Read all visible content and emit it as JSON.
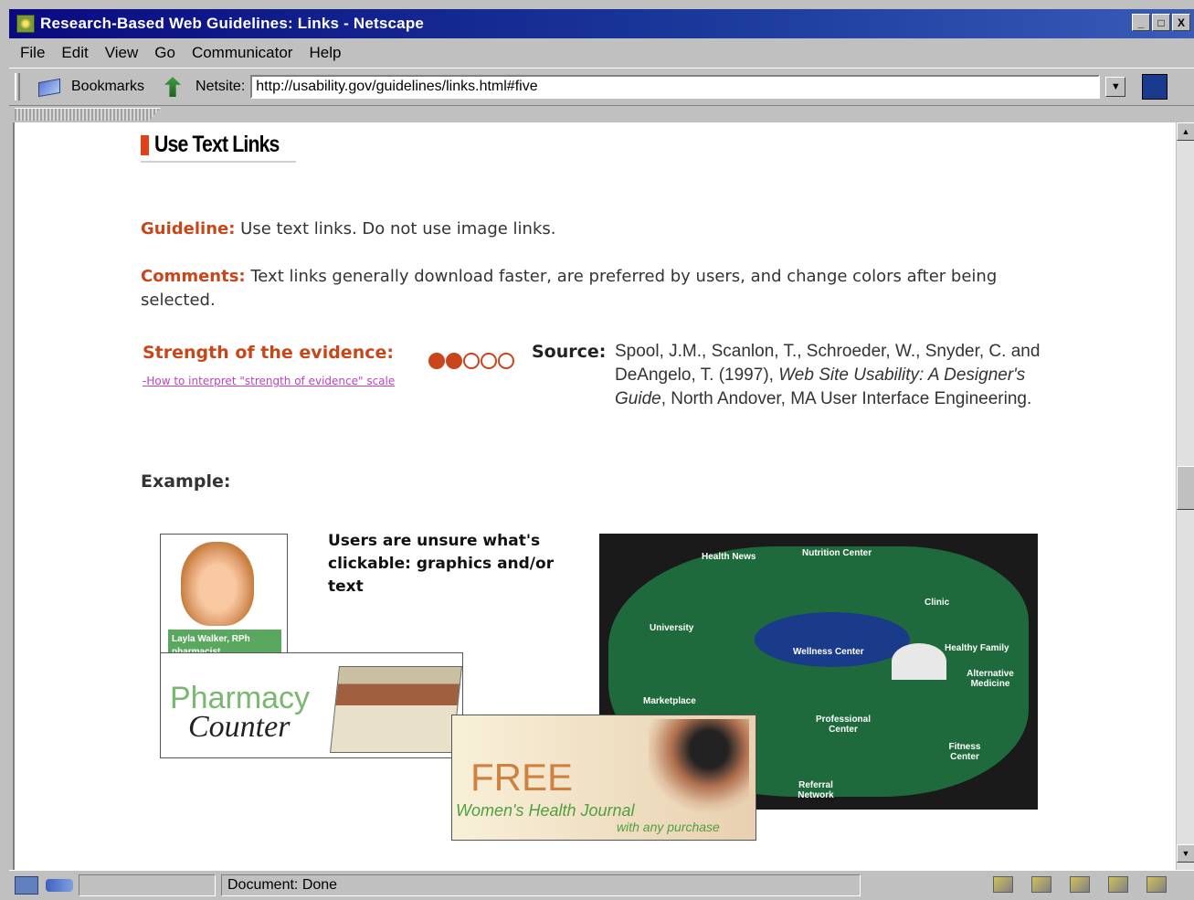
{
  "window": {
    "title": "Research-Based Web Guidelines: Links - Netscape",
    "controls": {
      "minimize": "_",
      "maximize": "□",
      "close": "X"
    }
  },
  "menu": {
    "items": [
      "File",
      "Edit",
      "View",
      "Go",
      "Communicator",
      "Help"
    ]
  },
  "toolbar": {
    "bookmarks_label": "Bookmarks",
    "location_label": "Netsite:",
    "url": "http://usability.gov/guidelines/links.html#five"
  },
  "page": {
    "heading": "Use Text Links",
    "guideline_label": "Guideline:",
    "guideline_text": " Use text links. Do not use image links.",
    "comments_label": "Comments:",
    "comments_text": " Text links generally download faster, are preferred by users, and change colors after being selected.",
    "strength_label": "Strength of the evidence:",
    "strength_level": 2,
    "strength_max": 5,
    "interpret_link": "-How to interpret \"strength of evidence\" scale",
    "source_label": "Source:",
    "source_pre": "Spool, J.M., Scanlon, T., Schroeder, W., Snyder, C. and DeAngelo, T. (1997), ",
    "source_title": "Web Site Usability: A Designer's Guide",
    "source_post": ", North Andover, MA User Interface Engineering.",
    "example_label": "Example:",
    "example_caption": "Users are unsure what's clickable: graphics and/or text",
    "example_images": {
      "photo_name": "Layla Walker, RPh",
      "photo_sub": "pharmacist",
      "pharmacy": "Pharmacy",
      "counter": "Counter",
      "free": "FREE",
      "journal": "Women's Health Journal",
      "purchase": "with any purchase",
      "map_labels": [
        "Health News",
        "Nutrition Center",
        "University",
        "Clinic",
        "Wellness Center",
        "Healthy Family",
        "Alternative Medicine",
        "Marketplace",
        "Professional Center",
        "Fitness Center",
        "Referral Network"
      ]
    }
  },
  "status": {
    "text": "Document: Done"
  },
  "colors": {
    "accent": "#c8461a",
    "link": "#c040c0",
    "titlebar": "#0a0a80"
  }
}
